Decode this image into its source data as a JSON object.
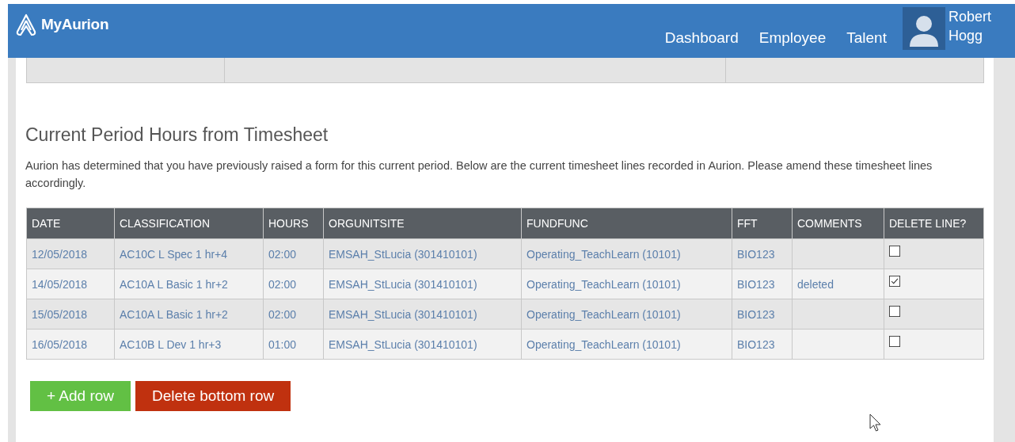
{
  "header": {
    "logo": "MyAurion",
    "nav": [
      {
        "label": "Dashboard"
      },
      {
        "label": "Employee"
      },
      {
        "label": "Talent"
      }
    ],
    "user": {
      "first_name": "Robert",
      "last_name": "Hogg"
    }
  },
  "section": {
    "title": "Current Period Hours from Timesheet",
    "text": "Aurion has determined that you have previously raised a form for this current period.  Below are the current timesheet lines recorded in Aurion.  Please amend these timesheet lines accordingly."
  },
  "table": {
    "columns": [
      "DATE",
      "CLASSIFICATION",
      "HOURS",
      "ORGUNITSITE",
      "FUNDFUNC",
      "FFT",
      "COMMENTS",
      "DELETE LINE?"
    ],
    "rows": [
      {
        "cells": [
          "12/05/2018",
          "AC10C L Spec 1 hr+4",
          "02:00",
          "EMSAH_StLucia (301410101)",
          "Operating_TeachLearn (10101)",
          "BIO123",
          ""
        ],
        "checked": false
      },
      {
        "cells": [
          "14/05/2018",
          "AC10A L Basic 1 hr+2",
          "02:00",
          "EMSAH_StLucia (301410101)",
          "Operating_TeachLearn (10101)",
          "BIO123",
          "deleted"
        ],
        "checked": true
      },
      {
        "cells": [
          "15/05/2018",
          "AC10A L Basic 1 hr+2",
          "02:00",
          "EMSAH_StLucia (301410101)",
          "Operating_TeachLearn (10101)",
          "BIO123",
          ""
        ],
        "checked": false
      },
      {
        "cells": [
          "16/05/2018",
          "AC10B L Dev 1 hr+3",
          "01:00",
          "EMSAH_StLucia (301410101)",
          "Operating_TeachLearn (10101)",
          "BIO123",
          ""
        ],
        "checked": false
      }
    ]
  },
  "buttons": [
    {
      "label": "+ Add row",
      "kind": "add"
    },
    {
      "label": "Delete bottom row",
      "kind": "delete"
    }
  ]
}
